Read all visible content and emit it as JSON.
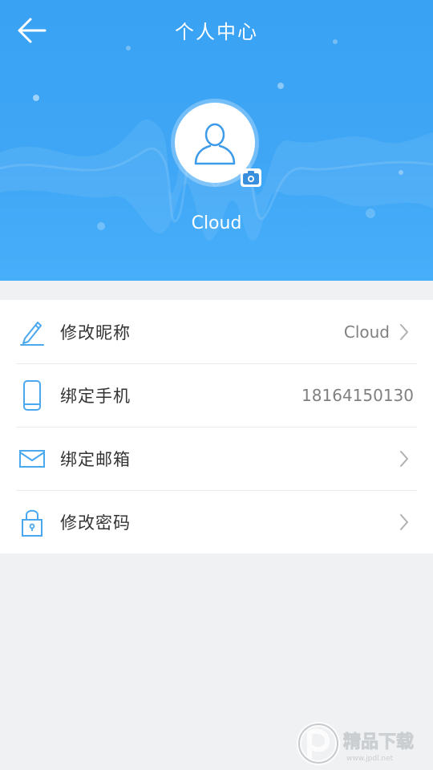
{
  "header": {
    "title": "个人中心",
    "username": "Cloud"
  },
  "icons": {
    "back": "back-arrow-icon",
    "avatar": "user-avatar-icon",
    "camera": "camera-icon",
    "nickname": "pencil-icon",
    "phone": "phone-icon",
    "email": "envelope-icon",
    "password": "lock-icon",
    "chevron": "chevron-right-icon"
  },
  "colors": {
    "header_blue": "#3ea6f5",
    "icon_blue": "#4aa8ee",
    "background": "#f0f1f3"
  },
  "settings": [
    {
      "label": "修改昵称",
      "value": "Cloud"
    },
    {
      "label": "绑定手机",
      "value": "18164150130"
    },
    {
      "label": "绑定邮箱",
      "value": ""
    },
    {
      "label": "修改密码",
      "value": ""
    }
  ],
  "watermark": {
    "text": "精品下载",
    "subtext": "www.jpdl.net"
  }
}
